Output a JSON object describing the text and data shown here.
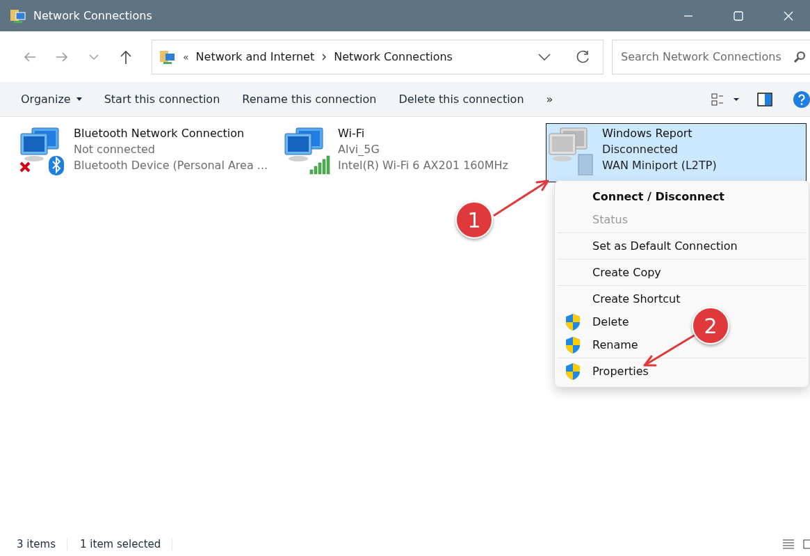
{
  "window": {
    "title": "Network Connections"
  },
  "address_bar": {
    "crumb_prefix": "«",
    "segments": [
      "Network and Internet",
      "Network Connections"
    ]
  },
  "search": {
    "placeholder": "Search Network Connections"
  },
  "command_bar": {
    "items": [
      {
        "label": "Organize",
        "dropdown": true
      },
      {
        "label": "Start this connection",
        "dropdown": false
      },
      {
        "label": "Rename this connection",
        "dropdown": false
      },
      {
        "label": "Delete this connection",
        "dropdown": false
      }
    ],
    "overflow": "»"
  },
  "connections": [
    {
      "kind": "bluetooth",
      "name": "Bluetooth Network Connection",
      "status": "Not connected",
      "device": "Bluetooth Device (Personal Area ...",
      "selected": false
    },
    {
      "kind": "wifi",
      "name": "Wi-Fi",
      "status": "Alvi_5G",
      "device": "Intel(R) Wi-Fi 6 AX201 160MHz",
      "selected": false
    },
    {
      "kind": "wan",
      "name": "Windows Report",
      "status": "Disconnected",
      "device": "WAN Miniport (L2TP)",
      "selected": true
    }
  ],
  "context_menu": {
    "groups": [
      [
        {
          "label": "Connect / Disconnect",
          "bold": true,
          "disabled": false,
          "shield": false
        },
        {
          "label": "Status",
          "bold": false,
          "disabled": true,
          "shield": false
        }
      ],
      [
        {
          "label": "Set as Default Connection",
          "bold": false,
          "disabled": false,
          "shield": false
        }
      ],
      [
        {
          "label": "Create Copy",
          "bold": false,
          "disabled": false,
          "shield": false
        }
      ],
      [
        {
          "label": "Create Shortcut",
          "bold": false,
          "disabled": false,
          "shield": false
        },
        {
          "label": "Delete",
          "bold": false,
          "disabled": false,
          "shield": true
        },
        {
          "label": "Rename",
          "bold": false,
          "disabled": false,
          "shield": true
        }
      ],
      [
        {
          "label": "Properties",
          "bold": false,
          "disabled": false,
          "shield": true
        }
      ]
    ]
  },
  "annotations": [
    {
      "number": "1"
    },
    {
      "number": "2"
    }
  ],
  "status_bar": {
    "items": [
      "3 items",
      "1 item selected"
    ]
  }
}
